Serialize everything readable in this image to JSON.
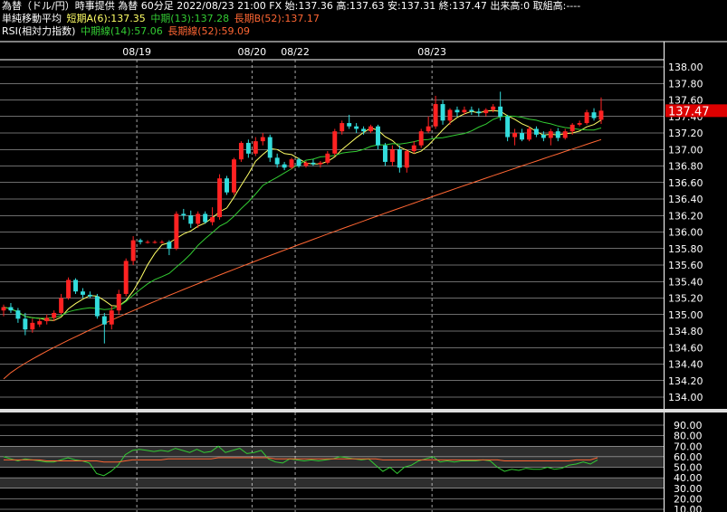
{
  "header": {
    "line1": "為替（ドル/円）時事提供 為替 60分足 2022/08/23 21:00 FX 始:137.36 高:137.63 安:137.31 終:137.47 出来高:0 取組高:----",
    "ma_title": "単純移動平均",
    "ma_short": "短期A(6):137.35",
    "ma_mid": "中期(13):137.28",
    "ma_long": "長期B(52):137.17",
    "rsi_title": "RSI(相対力指数)",
    "rsi_mid": "中期線(14):57.06",
    "rsi_long": "長期線(52):59.09"
  },
  "colors": {
    "background": "#000000",
    "ma_short": "#ffff66",
    "ma_mid": "#33cc33",
    "ma_long": "#ff6633",
    "candle_up": "#ff2222",
    "candle_down": "#33dddd",
    "price_badge": "#dd0000",
    "grid": "#ffffff"
  },
  "chart_data": [
    {
      "type": "candlestick",
      "title": "為替（ドル/円）60分足",
      "x_labels": [
        "08/19",
        "08/20",
        "08/22",
        "08/23"
      ],
      "ylim": [
        134.0,
        138.0
      ],
      "y_ticks": [
        "138.00",
        "137.80",
        "137.60",
        "137.40",
        "137.20",
        "137.00",
        "136.80",
        "136.60",
        "136.40",
        "136.20",
        "136.00",
        "135.80",
        "135.60",
        "135.40",
        "135.20",
        "135.00",
        "134.80",
        "134.60",
        "134.40",
        "134.20",
        "134.00"
      ],
      "last_price": "137.47",
      "candles": [
        {
          "o": 135.05,
          "h": 135.12,
          "l": 134.98,
          "c": 135.09
        },
        {
          "o": 135.09,
          "h": 135.14,
          "l": 135.02,
          "c": 135.05
        },
        {
          "o": 135.05,
          "h": 135.08,
          "l": 134.9,
          "c": 134.95
        },
        {
          "o": 134.95,
          "h": 135.02,
          "l": 134.75,
          "c": 134.82
        },
        {
          "o": 134.82,
          "h": 134.95,
          "l": 134.78,
          "c": 134.9
        },
        {
          "o": 134.88,
          "h": 134.95,
          "l": 134.85,
          "c": 134.92
        },
        {
          "o": 134.92,
          "h": 135.0,
          "l": 134.88,
          "c": 134.96
        },
        {
          "o": 134.96,
          "h": 135.05,
          "l": 134.92,
          "c": 135.02
        },
        {
          "o": 135.02,
          "h": 135.25,
          "l": 135.0,
          "c": 135.2
        },
        {
          "o": 135.2,
          "h": 135.45,
          "l": 135.18,
          "c": 135.42
        },
        {
          "o": 135.42,
          "h": 135.44,
          "l": 135.25,
          "c": 135.28
        },
        {
          "o": 135.28,
          "h": 135.32,
          "l": 135.2,
          "c": 135.24
        },
        {
          "o": 135.24,
          "h": 135.28,
          "l": 135.2,
          "c": 135.22
        },
        {
          "o": 135.22,
          "h": 135.25,
          "l": 134.95,
          "c": 134.98
        },
        {
          "o": 134.98,
          "h": 135.02,
          "l": 134.65,
          "c": 134.88
        },
        {
          "o": 134.88,
          "h": 135.1,
          "l": 134.82,
          "c": 135.05
        },
        {
          "o": 135.05,
          "h": 135.3,
          "l": 135.0,
          "c": 135.25
        },
        {
          "o": 135.25,
          "h": 135.68,
          "l": 135.22,
          "c": 135.65
        },
        {
          "o": 135.65,
          "h": 135.95,
          "l": 135.6,
          "c": 135.9
        },
        {
          "o": 135.9,
          "h": 135.92,
          "l": 135.85,
          "c": 135.88
        },
        {
          "o": 135.88,
          "h": 135.9,
          "l": 135.86,
          "c": 135.88
        },
        {
          "o": 135.88,
          "h": 135.9,
          "l": 135.86,
          "c": 135.88
        },
        {
          "o": 135.88,
          "h": 135.9,
          "l": 135.86,
          "c": 135.88
        },
        {
          "o": 135.88,
          "h": 135.9,
          "l": 135.72,
          "c": 135.8
        },
        {
          "o": 135.8,
          "h": 136.25,
          "l": 135.78,
          "c": 136.22
        },
        {
          "o": 136.22,
          "h": 136.28,
          "l": 136.15,
          "c": 136.2
        },
        {
          "o": 136.2,
          "h": 136.26,
          "l": 136.05,
          "c": 136.1
        },
        {
          "o": 136.1,
          "h": 136.25,
          "l": 136.05,
          "c": 136.22
        },
        {
          "o": 136.22,
          "h": 136.25,
          "l": 136.1,
          "c": 136.12
        },
        {
          "o": 136.12,
          "h": 136.3,
          "l": 136.08,
          "c": 136.18
        },
        {
          "o": 136.18,
          "h": 136.7,
          "l": 136.15,
          "c": 136.65
        },
        {
          "o": 136.65,
          "h": 136.68,
          "l": 136.45,
          "c": 136.48
        },
        {
          "o": 136.48,
          "h": 136.9,
          "l": 136.45,
          "c": 136.88
        },
        {
          "o": 136.88,
          "h": 137.1,
          "l": 136.85,
          "c": 137.08
        },
        {
          "o": 137.08,
          "h": 137.12,
          "l": 136.9,
          "c": 136.95
        },
        {
          "o": 136.95,
          "h": 137.15,
          "l": 136.92,
          "c": 137.1
        },
        {
          "o": 137.1,
          "h": 137.2,
          "l": 137.05,
          "c": 137.15
        },
        {
          "o": 137.15,
          "h": 137.18,
          "l": 136.85,
          "c": 136.9
        },
        {
          "o": 136.9,
          "h": 136.95,
          "l": 136.78,
          "c": 136.82
        },
        {
          "o": 136.82,
          "h": 136.85,
          "l": 136.75,
          "c": 136.78
        },
        {
          "o": 136.78,
          "h": 136.9,
          "l": 136.76,
          "c": 136.88
        },
        {
          "o": 136.88,
          "h": 136.9,
          "l": 136.78,
          "c": 136.8
        },
        {
          "o": 136.8,
          "h": 136.86,
          "l": 136.78,
          "c": 136.84
        },
        {
          "o": 136.84,
          "h": 136.88,
          "l": 136.8,
          "c": 136.82
        },
        {
          "o": 136.82,
          "h": 136.86,
          "l": 136.78,
          "c": 136.84
        },
        {
          "o": 136.84,
          "h": 136.98,
          "l": 136.82,
          "c": 136.95
        },
        {
          "o": 136.95,
          "h": 137.25,
          "l": 136.92,
          "c": 137.22
        },
        {
          "o": 137.22,
          "h": 137.35,
          "l": 137.18,
          "c": 137.32
        },
        {
          "o": 137.32,
          "h": 137.42,
          "l": 137.25,
          "c": 137.28
        },
        {
          "o": 137.28,
          "h": 137.32,
          "l": 137.2,
          "c": 137.25
        },
        {
          "o": 137.25,
          "h": 137.28,
          "l": 137.18,
          "c": 137.22
        },
        {
          "o": 137.22,
          "h": 137.3,
          "l": 137.2,
          "c": 137.28
        },
        {
          "o": 137.28,
          "h": 137.3,
          "l": 137.0,
          "c": 137.05
        },
        {
          "o": 137.05,
          "h": 137.08,
          "l": 136.8,
          "c": 136.85
        },
        {
          "o": 136.85,
          "h": 137.05,
          "l": 136.8,
          "c": 137.0
        },
        {
          "o": 137.0,
          "h": 137.05,
          "l": 136.72,
          "c": 136.78
        },
        {
          "o": 136.78,
          "h": 137.0,
          "l": 136.72,
          "c": 136.98
        },
        {
          "o": 136.98,
          "h": 137.1,
          "l": 136.95,
          "c": 137.05
        },
        {
          "o": 137.05,
          "h": 137.25,
          "l": 137.02,
          "c": 137.22
        },
        {
          "o": 137.22,
          "h": 137.4,
          "l": 137.2,
          "c": 137.28
        },
        {
          "o": 137.28,
          "h": 137.65,
          "l": 137.25,
          "c": 137.55
        },
        {
          "o": 137.55,
          "h": 137.6,
          "l": 137.3,
          "c": 137.35
        },
        {
          "o": 137.35,
          "h": 137.5,
          "l": 137.3,
          "c": 137.48
        },
        {
          "o": 137.48,
          "h": 137.52,
          "l": 137.4,
          "c": 137.45
        },
        {
          "o": 137.45,
          "h": 137.52,
          "l": 137.42,
          "c": 137.48
        },
        {
          "o": 137.48,
          "h": 137.52,
          "l": 137.42,
          "c": 137.46
        },
        {
          "o": 137.46,
          "h": 137.5,
          "l": 137.4,
          "c": 137.44
        },
        {
          "o": 137.44,
          "h": 137.5,
          "l": 137.4,
          "c": 137.48
        },
        {
          "o": 137.48,
          "h": 137.55,
          "l": 137.45,
          "c": 137.52
        },
        {
          "o": 137.52,
          "h": 137.7,
          "l": 137.35,
          "c": 137.4
        },
        {
          "o": 137.4,
          "h": 137.42,
          "l": 137.1,
          "c": 137.15
        },
        {
          "o": 137.15,
          "h": 137.25,
          "l": 137.05,
          "c": 137.2
        },
        {
          "o": 137.2,
          "h": 137.25,
          "l": 137.1,
          "c": 137.12
        },
        {
          "o": 137.12,
          "h": 137.28,
          "l": 137.1,
          "c": 137.25
        },
        {
          "o": 137.25,
          "h": 137.28,
          "l": 137.15,
          "c": 137.18
        },
        {
          "o": 137.18,
          "h": 137.22,
          "l": 137.1,
          "c": 137.14
        },
        {
          "o": 137.14,
          "h": 137.25,
          "l": 137.05,
          "c": 137.22
        },
        {
          "o": 137.22,
          "h": 137.26,
          "l": 137.1,
          "c": 137.14
        },
        {
          "o": 137.14,
          "h": 137.25,
          "l": 137.12,
          "c": 137.22
        },
        {
          "o": 137.22,
          "h": 137.32,
          "l": 137.18,
          "c": 137.3
        },
        {
          "o": 137.3,
          "h": 137.35,
          "l": 137.28,
          "c": 137.32
        },
        {
          "o": 137.32,
          "h": 137.48,
          "l": 137.3,
          "c": 137.45
        },
        {
          "o": 137.45,
          "h": 137.5,
          "l": 137.35,
          "c": 137.38
        },
        {
          "o": 137.36,
          "h": 137.63,
          "l": 137.31,
          "c": 137.47
        }
      ],
      "date_candle_index": [
        19,
        35,
        41,
        60
      ]
    },
    {
      "type": "line",
      "title": "RSI(相対力指数)",
      "ylim": [
        0,
        100
      ],
      "y_ticks": [
        "90.00",
        "80.00",
        "70.00",
        "60.00",
        "50.00",
        "40.00",
        "30.00",
        "20.00",
        "10.00"
      ],
      "series": [
        {
          "name": "中期線(14)",
          "values": [
            60,
            58,
            56,
            58,
            57,
            56,
            55,
            55,
            57,
            59,
            57,
            56,
            54,
            44,
            42,
            46,
            52,
            62,
            66,
            67,
            66,
            65,
            66,
            65,
            68,
            66,
            64,
            67,
            64,
            65,
            70,
            64,
            66,
            68,
            63,
            64,
            66,
            58,
            55,
            54,
            58,
            57,
            56,
            57,
            56,
            57,
            58,
            60,
            59,
            58,
            57,
            58,
            52,
            46,
            50,
            44,
            50,
            52,
            56,
            58,
            60,
            55,
            56,
            55,
            56,
            56,
            56,
            57,
            56,
            50,
            46,
            48,
            47,
            49,
            48,
            48,
            50,
            48,
            49,
            52,
            53,
            55,
            53,
            57
          ]
        },
        {
          "name": "長期線(52)",
          "values": [
            57,
            57,
            57,
            57,
            57,
            57,
            56,
            56,
            56,
            56,
            56,
            56,
            56,
            56,
            55,
            55,
            55,
            56,
            57,
            57,
            57,
            57,
            57,
            58,
            58,
            58,
            58,
            58,
            58,
            58,
            59,
            59,
            59,
            59,
            59,
            59,
            59,
            59,
            58,
            58,
            58,
            58,
            58,
            58,
            58,
            58,
            58,
            58,
            58,
            58,
            58,
            58,
            58,
            57,
            57,
            57,
            57,
            57,
            57,
            57,
            57,
            57,
            57,
            57,
            57,
            57,
            57,
            57,
            57,
            57,
            56,
            56,
            56,
            56,
            56,
            56,
            56,
            56,
            56,
            56,
            57,
            57,
            57,
            59
          ]
        }
      ]
    }
  ]
}
